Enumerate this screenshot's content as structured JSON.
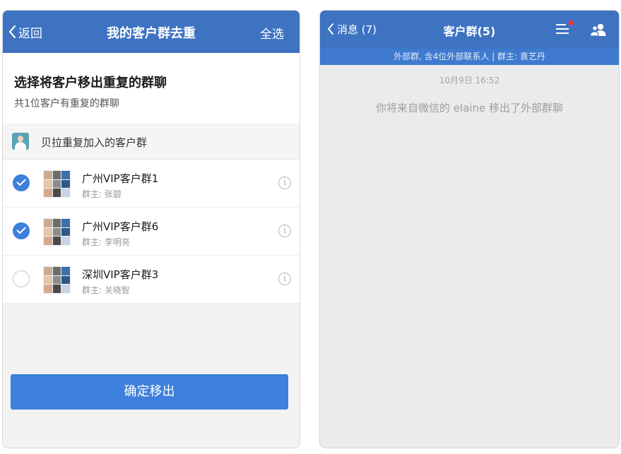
{
  "left_screen": {
    "nav": {
      "back_label": "返回",
      "title": "我的客户群去重",
      "select_all_label": "全选"
    },
    "heading": "选择将客户移出重复的群聊",
    "subheading": "共1位客户有重复的群聊",
    "member_label": "贝拉重复加入的客户群",
    "groups": [
      {
        "name": "广州VIP客户群1",
        "owner": "群主: 张碧",
        "checked": true
      },
      {
        "name": "广州VIP客户群6",
        "owner": "群主: 李明亮",
        "checked": true
      },
      {
        "name": "深圳VIP客户群3",
        "owner": "群主: 关晓智",
        "checked": false
      }
    ],
    "info_glyph": "i",
    "confirm_label": "确定移出"
  },
  "right_screen": {
    "nav": {
      "back_label": "消息 (7)",
      "title": "客户群(5)"
    },
    "subtitle": "外部群, 含4位外部联系人 | 群主: 袁艺丹",
    "timestamp": "10月9日 16:52",
    "system_message": "你将来自微信的 elaine 移出了外部群聊"
  },
  "colors": {
    "nav_blue": "#3e73c2",
    "accent_blue": "#3d7fdb",
    "notification_dot": "#ff3333"
  },
  "icons": [
    "chevron-left-icon",
    "checkmark-icon",
    "info-icon",
    "menu-icon",
    "group-members-icon",
    "avatar"
  ]
}
